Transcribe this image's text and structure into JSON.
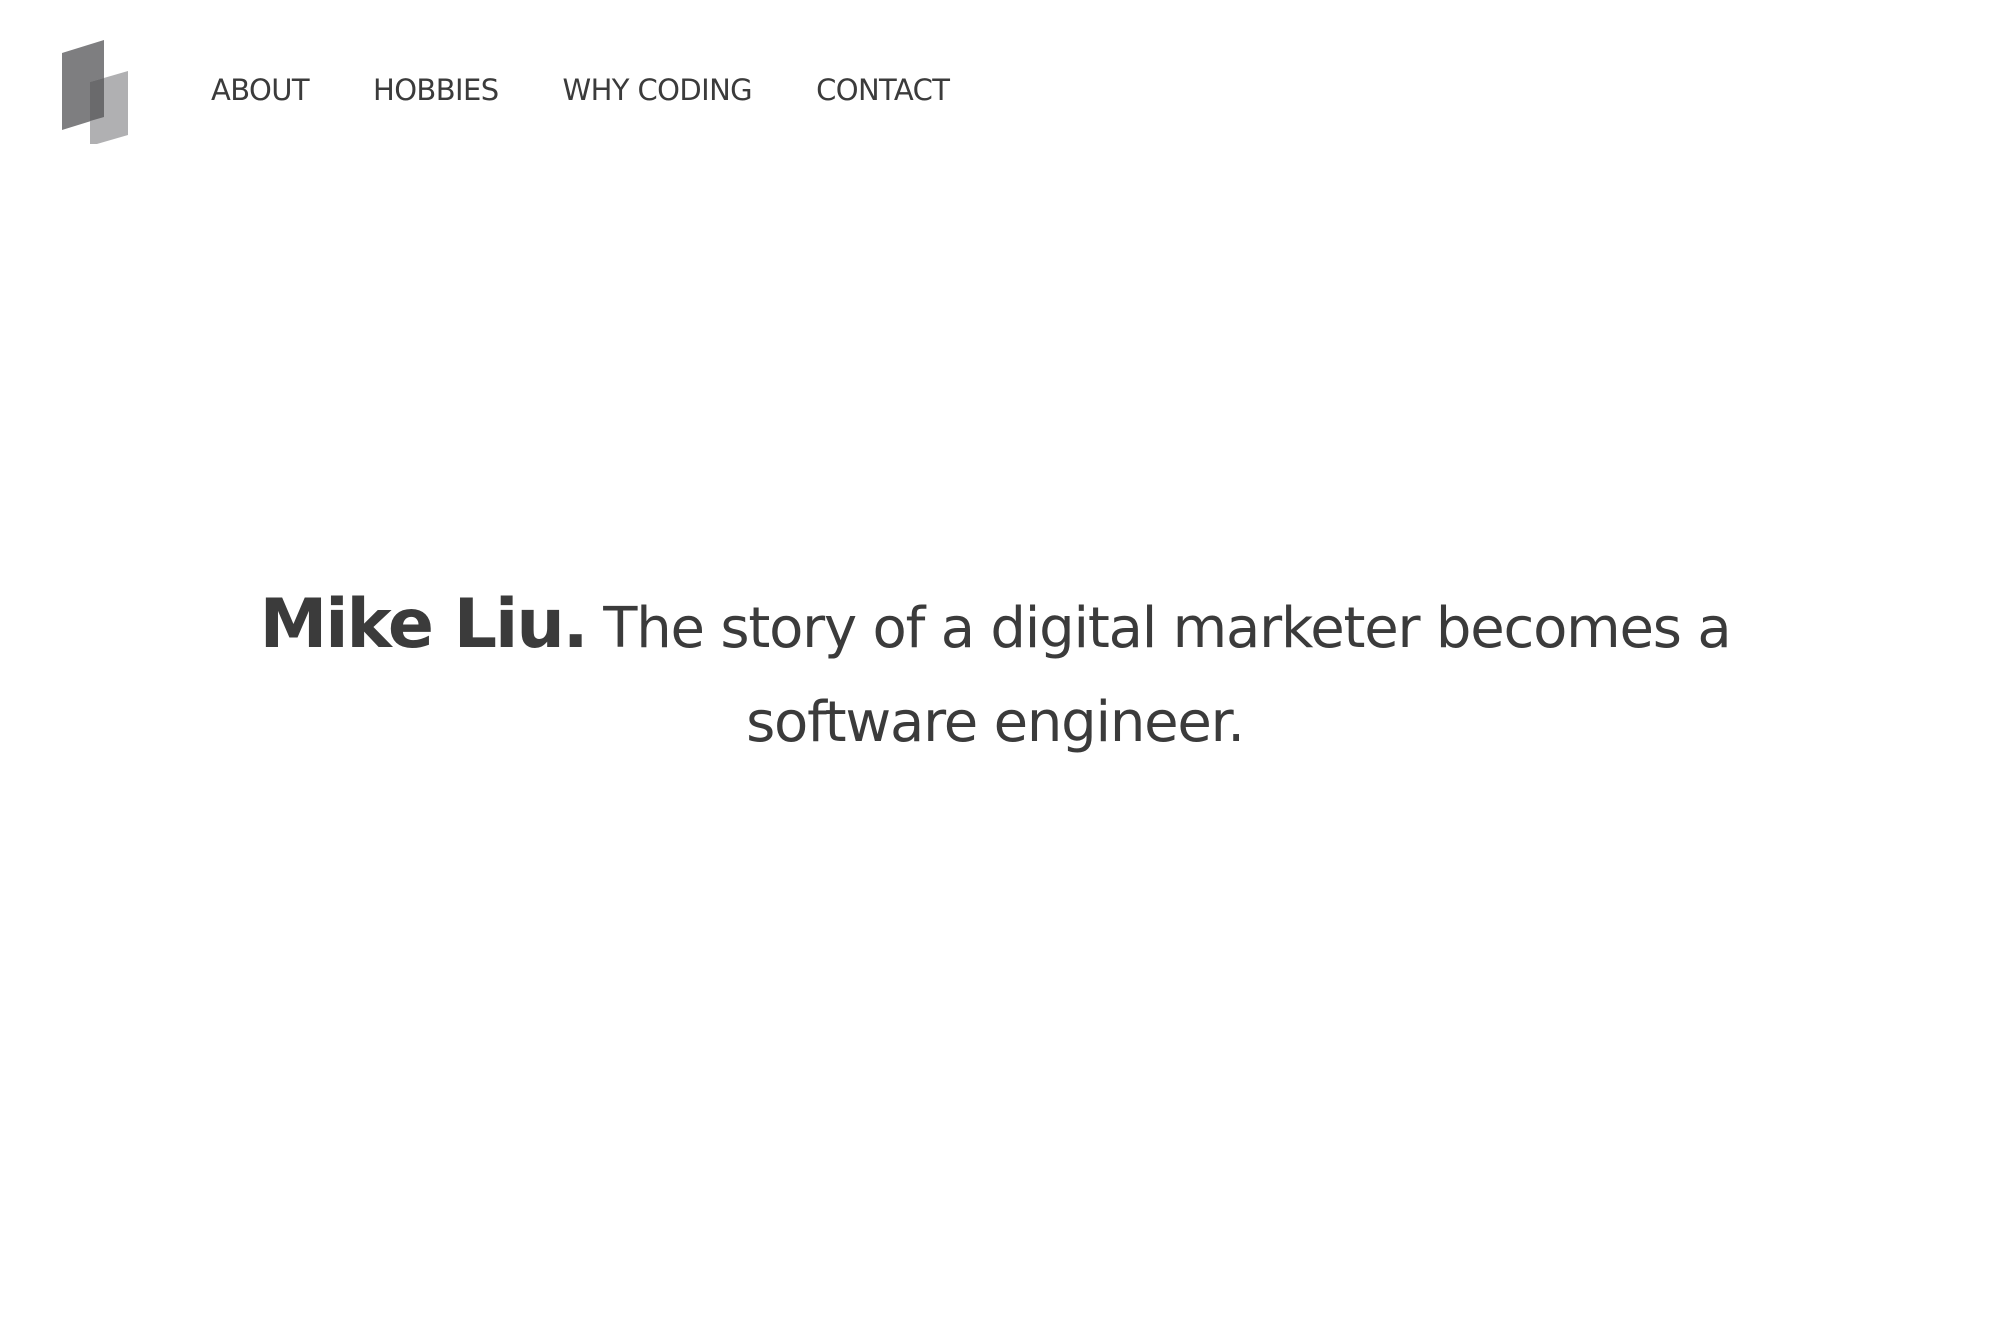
{
  "nav": {
    "items": [
      {
        "label": "ABOUT"
      },
      {
        "label": "HOBBIES"
      },
      {
        "label": "WHY CODING"
      },
      {
        "label": "CONTACT"
      }
    ]
  },
  "hero": {
    "name": "Mike Liu.",
    "tagline": "The story of a digital marketer becomes a software engineer."
  },
  "icons": {
    "logo": "stacked-panels-logo-icon"
  },
  "colors": {
    "text": "#3b3b3b",
    "background": "#ffffff",
    "logo_dark": "#7a7a7c",
    "logo_light": "#a8a8aa"
  }
}
